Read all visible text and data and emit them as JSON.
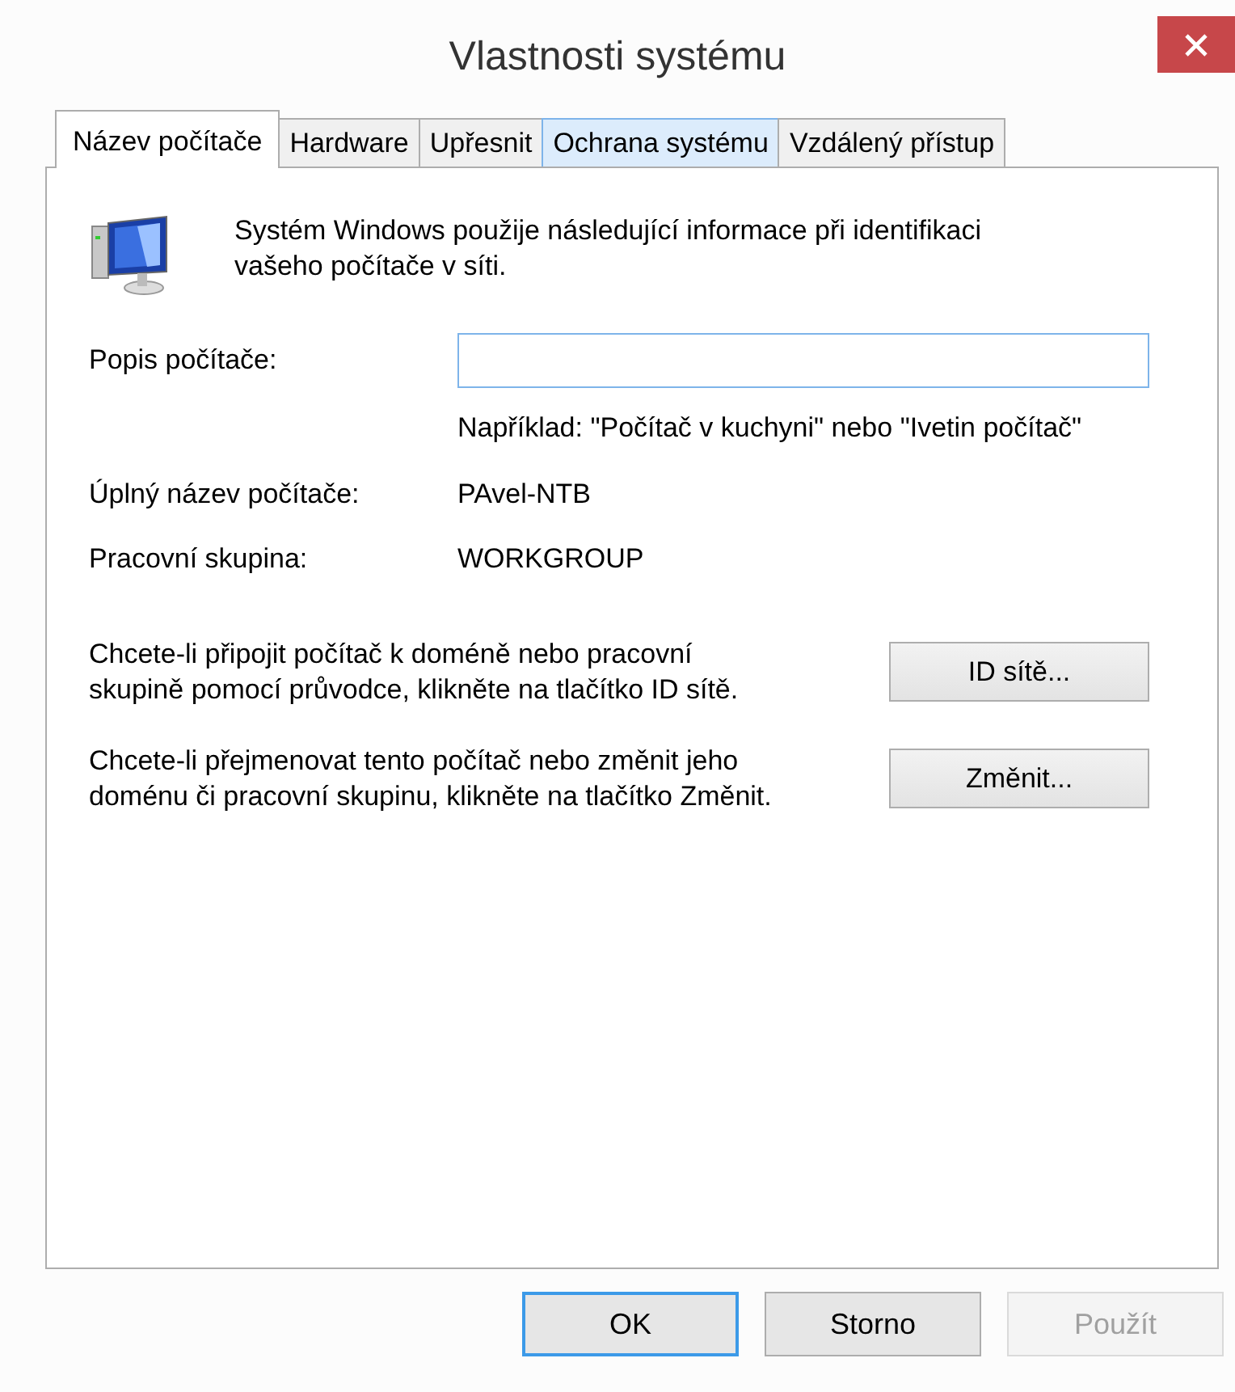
{
  "window": {
    "title": "Vlastnosti systému"
  },
  "tabs": [
    {
      "label": "Název počítače",
      "selected": true,
      "hovered": false
    },
    {
      "label": "Hardware",
      "selected": false,
      "hovered": false
    },
    {
      "label": "Upřesnit",
      "selected": false,
      "hovered": false
    },
    {
      "label": "Ochrana systému",
      "selected": false,
      "hovered": true
    },
    {
      "label": "Vzdálený přístup",
      "selected": false,
      "hovered": false
    }
  ],
  "intro": "Systém Windows použije následující informace při identifikaci vašeho počítače v síti.",
  "description": {
    "label": "Popis počítače:",
    "example": "Například: \"Počítač v kuchyni\" nebo \"Ivetin počítač\""
  },
  "info": [
    {
      "label": "Úplný název počítače:",
      "value": "PAvel-NTB"
    },
    {
      "label": "Pracovní skupina:",
      "value": "WORKGROUP"
    }
  ],
  "actions": [
    {
      "text": "Chcete-li připojit počítač k doméně nebo pracovní skupině pomocí průvodce, klikněte na tlačítko ID sítě.",
      "button": "ID sítě..."
    },
    {
      "text": "Chcete-li přejmenovat tento počítač nebo změnit jeho doménu či pracovní skupinu, klikněte na tlačítko Změnit.",
      "button": "Změnit..."
    }
  ],
  "buttons": [
    {
      "label": "OK",
      "default": true,
      "disabled": false
    },
    {
      "label": "Storno",
      "default": false,
      "disabled": false
    },
    {
      "label": "Použít",
      "default": false,
      "disabled": true
    }
  ]
}
